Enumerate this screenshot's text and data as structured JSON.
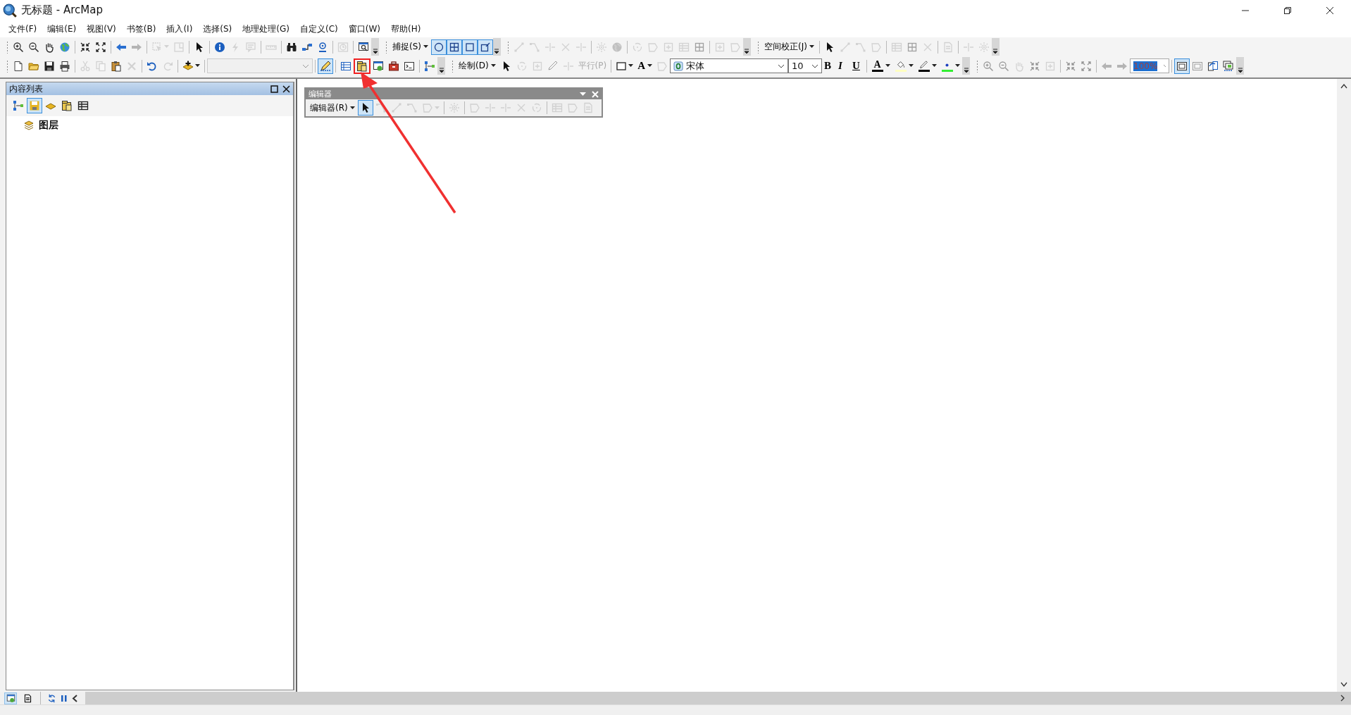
{
  "window": {
    "title": "无标题 - ArcMap"
  },
  "menu": [
    "文件(F)",
    "编辑(E)",
    "视图(V)",
    "书签(B)",
    "插入(I)",
    "选择(S)",
    "地理处理(G)",
    "自定义(C)",
    "窗口(W)",
    "帮助(H)"
  ],
  "toolbar_1": [
    {
      "kind": "grip"
    },
    {
      "kind": "tool",
      "disabled": false
    },
    {
      "kind": "tool",
      "disabled": false
    },
    {
      "kind": "tool",
      "disabled": false
    },
    {
      "kind": "tool",
      "disabled": false
    },
    {
      "kind": "sep"
    },
    {
      "kind": "tool",
      "disabled": false
    },
    {
      "kind": "tool",
      "disabled": false
    },
    {
      "kind": "sep"
    },
    {
      "kind": "tool",
      "disabled": false
    },
    {
      "kind": "tool",
      "disabled": true
    },
    {
      "kind": "sep"
    },
    {
      "kind": "tool",
      "disabled": true,
      "caret": true
    },
    {
      "kind": "tool",
      "disabled": true
    },
    {
      "kind": "sep"
    },
    {
      "kind": "tool",
      "disabled": false
    },
    {
      "kind": "sep"
    },
    {
      "kind": "tool",
      "disabled": false
    },
    {
      "kind": "tool",
      "disabled": true
    },
    {
      "kind": "tool",
      "disabled": true
    },
    {
      "kind": "sep"
    },
    {
      "kind": "tool",
      "disabled": true
    },
    {
      "kind": "sep"
    },
    {
      "kind": "tool",
      "disabled": false
    },
    {
      "kind": "tool",
      "disabled": false
    },
    {
      "kind": "tool",
      "disabled": false
    },
    {
      "kind": "sep"
    },
    {
      "kind": "tool",
      "disabled": true
    },
    {
      "kind": "sep"
    },
    {
      "kind": "tool",
      "disabled": false
    },
    {
      "kind": "overflow"
    },
    {
      "kind": "grip"
    },
    {
      "kind": "menu",
      "label": "捕捉(S)"
    },
    {
      "kind": "tool",
      "disabled": false,
      "on": true
    },
    {
      "kind": "tool",
      "disabled": false,
      "on": true
    },
    {
      "kind": "tool",
      "disabled": false,
      "on": true
    },
    {
      "kind": "tool",
      "disabled": false,
      "on": true
    },
    {
      "kind": "overflow"
    },
    {
      "kind": "grip"
    },
    {
      "kind": "tool",
      "disabled": true
    },
    {
      "kind": "tool",
      "disabled": true
    },
    {
      "kind": "tool",
      "disabled": true
    },
    {
      "kind": "tool",
      "disabled": true
    },
    {
      "kind": "tool",
      "disabled": true
    },
    {
      "kind": "sep"
    },
    {
      "kind": "tool",
      "disabled": true
    },
    {
      "kind": "tool",
      "disabled": true
    },
    {
      "kind": "sep"
    },
    {
      "kind": "tool",
      "disabled": true
    },
    {
      "kind": "tool",
      "disabled": true
    },
    {
      "kind": "tool",
      "disabled": true
    },
    {
      "kind": "tool",
      "disabled": true
    },
    {
      "kind": "tool",
      "disabled": true
    },
    {
      "kind": "sep"
    },
    {
      "kind": "tool",
      "disabled": true
    },
    {
      "kind": "tool",
      "disabled": true
    },
    {
      "kind": "overflow"
    },
    {
      "kind": "grip"
    },
    {
      "kind": "menu",
      "label": "空间校正(J)"
    },
    {
      "kind": "sep"
    },
    {
      "kind": "tool",
      "disabled": false
    },
    {
      "kind": "tool",
      "disabled": true
    },
    {
      "kind": "tool",
      "disabled": true
    },
    {
      "kind": "tool",
      "disabled": true
    },
    {
      "kind": "sep"
    },
    {
      "kind": "tool",
      "disabled": true
    },
    {
      "kind": "tool",
      "disabled": true
    },
    {
      "kind": "tool",
      "disabled": true
    },
    {
      "kind": "sep"
    },
    {
      "kind": "tool",
      "disabled": true
    },
    {
      "kind": "sep"
    },
    {
      "kind": "tool",
      "disabled": true
    },
    {
      "kind": "tool",
      "disabled": true
    },
    {
      "kind": "overflow"
    }
  ],
  "toolbar_2": [
    {
      "kind": "grip"
    },
    {
      "kind": "tool",
      "disabled": false
    },
    {
      "kind": "tool",
      "disabled": false
    },
    {
      "kind": "tool",
      "disabled": false
    },
    {
      "kind": "tool",
      "disabled": false
    },
    {
      "kind": "sep"
    },
    {
      "kind": "tool",
      "disabled": true
    },
    {
      "kind": "tool",
      "disabled": true
    },
    {
      "kind": "tool",
      "disabled": false
    },
    {
      "kind": "tool",
      "disabled": true
    },
    {
      "kind": "sep"
    },
    {
      "kind": "tool",
      "disabled": false
    },
    {
      "kind": "tool",
      "disabled": true
    },
    {
      "kind": "sep"
    },
    {
      "kind": "tool",
      "disabled": false,
      "caret": true
    },
    {
      "kind": "sep"
    },
    {
      "kind": "scale-combo"
    },
    {
      "kind": "sep"
    },
    {
      "kind": "tool",
      "disabled": false,
      "on": true
    },
    {
      "kind": "sep"
    },
    {
      "kind": "tool",
      "disabled": false
    },
    {
      "kind": "tool",
      "disabled": false,
      "highlighted": true
    },
    {
      "kind": "tool",
      "disabled": false
    },
    {
      "kind": "tool",
      "disabled": false
    },
    {
      "kind": "tool",
      "disabled": false
    },
    {
      "kind": "sep"
    },
    {
      "kind": "tool",
      "disabled": false
    },
    {
      "kind": "overflow"
    },
    {
      "kind": "grip"
    },
    {
      "kind": "menu",
      "label": "绘制(D)"
    },
    {
      "kind": "tool",
      "disabled": false
    },
    {
      "kind": "tool",
      "disabled": true
    },
    {
      "kind": "tool",
      "disabled": true
    },
    {
      "kind": "tool",
      "disabled": true
    },
    {
      "kind": "tool",
      "disabled": true
    },
    {
      "kind": "text-tool",
      "label": "平行(P)",
      "disabled": true
    },
    {
      "kind": "sep"
    },
    {
      "kind": "tool",
      "disabled": false,
      "caret": true
    },
    {
      "kind": "font-tool",
      "label": "A",
      "caret": true
    },
    {
      "kind": "tool",
      "disabled": true
    },
    {
      "kind": "font-combo",
      "value": "宋体"
    },
    {
      "kind": "size-combo",
      "value": "10"
    },
    {
      "kind": "bold-tool",
      "label": "B"
    },
    {
      "kind": "italic-tool",
      "label": "I"
    },
    {
      "kind": "underline-tool",
      "label": "U"
    },
    {
      "kind": "sep"
    },
    {
      "kind": "color-tool",
      "label": "A",
      "color": "#000000"
    },
    {
      "kind": "color-tool",
      "color": "#ffffc0"
    },
    {
      "kind": "color-tool",
      "color": "#000000"
    },
    {
      "kind": "color-tool",
      "color": "#33ee33"
    },
    {
      "kind": "overflow"
    },
    {
      "kind": "grip"
    },
    {
      "kind": "tool",
      "disabled": true
    },
    {
      "kind": "tool",
      "disabled": true
    },
    {
      "kind": "tool",
      "disabled": true
    },
    {
      "kind": "tool",
      "disabled": true
    },
    {
      "kind": "tool",
      "disabled": true
    },
    {
      "kind": "sep"
    },
    {
      "kind": "tool",
      "disabled": true
    },
    {
      "kind": "tool",
      "disabled": true
    },
    {
      "kind": "sep"
    },
    {
      "kind": "tool",
      "disabled": true
    },
    {
      "kind": "tool",
      "disabled": true
    },
    {
      "kind": "zoom-combo",
      "value": "100%"
    },
    {
      "kind": "sep"
    },
    {
      "kind": "tool",
      "disabled": false,
      "on": true
    },
    {
      "kind": "tool",
      "disabled": true
    },
    {
      "kind": "tool",
      "disabled": false
    },
    {
      "kind": "tool",
      "disabled": false
    },
    {
      "kind": "overflow"
    }
  ],
  "toc": {
    "title": "内容列表",
    "tabs": [
      {
        "selected": false
      },
      {
        "selected": true
      },
      {
        "selected": false
      },
      {
        "selected": false
      },
      {
        "selected": false
      }
    ],
    "root": "图层"
  },
  "editor_toolbar": {
    "title": "编辑器",
    "menu": "编辑器(R)",
    "tools": [
      {
        "disabled": false,
        "on": true
      },
      {
        "disabled": true
      },
      {
        "disabled": true
      },
      {
        "disabled": true
      },
      {
        "disabled": true,
        "caret": true
      },
      {
        "disabled": true
      },
      {
        "disabled": true
      },
      {
        "disabled": true
      },
      {
        "disabled": true
      },
      {
        "disabled": true
      },
      {
        "disabled": true
      },
      {
        "disabled": true
      },
      {
        "disabled": true
      },
      {
        "disabled": true
      }
    ]
  },
  "view_tabs": [
    {
      "selected": true
    },
    {
      "selected": false
    }
  ]
}
